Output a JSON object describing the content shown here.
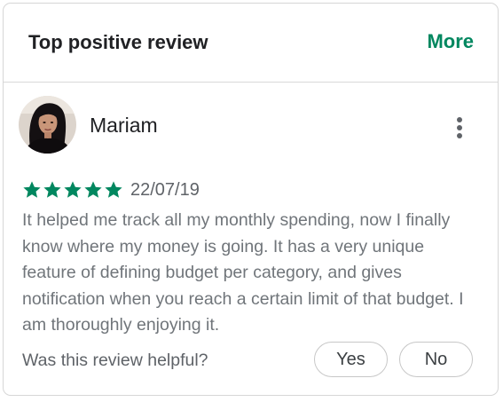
{
  "header": {
    "title": "Top positive review",
    "more_label": "More"
  },
  "review": {
    "reviewer_name": "Mariam",
    "rating": 5,
    "max_rating": 5,
    "date": "22/07/19",
    "text": "It helped me track all my monthly spending, now I finally know where my money is going. It has a very unique feature of defining budget per category, and gives notification when you reach a certain limit of that budget. I am thoroughly enjoying it."
  },
  "helpful": {
    "question": "Was this review helpful?",
    "yes_label": "Yes",
    "no_label": "No"
  },
  "icons": {
    "overflow": "more-vert-icon",
    "star": "star-icon"
  },
  "colors": {
    "accent": "#01875f",
    "star": "#01875f",
    "text_primary": "#202124",
    "text_secondary": "#70757a"
  }
}
